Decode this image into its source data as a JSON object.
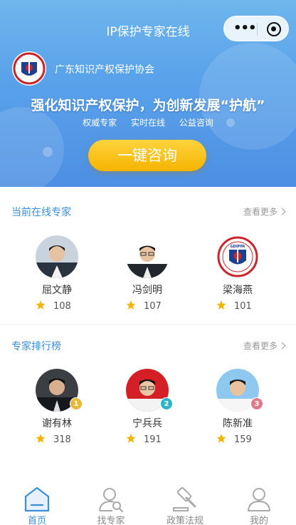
{
  "header": {
    "title": "IP保护专家在线"
  },
  "banner": {
    "org_name": "广东知识产权保护协会",
    "slogan": "强化知识产权保护，为创新发展“护航”",
    "tags": [
      "权威专家",
      "实时在线",
      "公益咨询"
    ],
    "consult_button": "一键咨询",
    "logo_text": "GDIPPA"
  },
  "online": {
    "title": "当前在线专家",
    "more": "查看更多",
    "experts": [
      {
        "name": "屈文静",
        "score": "108"
      },
      {
        "name": "冯剑明",
        "score": "107"
      },
      {
        "name": "梁海燕",
        "score": "101"
      }
    ]
  },
  "ranking": {
    "title": "专家排行榜",
    "more": "查看更多",
    "experts": [
      {
        "name": "谢有林",
        "score": "318",
        "rank": "1"
      },
      {
        "name": "宁兵兵",
        "score": "191",
        "rank": "2"
      },
      {
        "name": "陈新准",
        "score": "159",
        "rank": "3"
      }
    ]
  },
  "tabbar": {
    "items": [
      {
        "label": "首页",
        "icon": "home-icon",
        "active": true
      },
      {
        "label": "找专家",
        "icon": "find-expert-icon",
        "active": false
      },
      {
        "label": "政策法规",
        "icon": "gavel-icon",
        "active": false
      },
      {
        "label": "我的",
        "icon": "user-icon",
        "active": false
      }
    ]
  },
  "colors": {
    "accent": "#3a8fd8",
    "button": "#f5b400",
    "rank1": "#e8b83a",
    "rank2": "#2fb3c9",
    "rank3": "#e0798a",
    "star": "#f5b400"
  }
}
